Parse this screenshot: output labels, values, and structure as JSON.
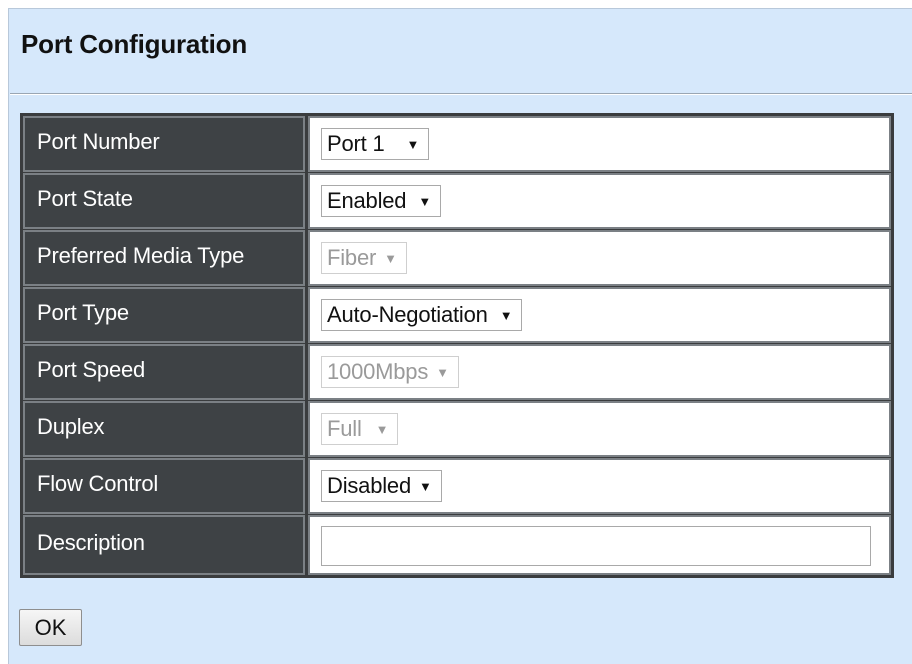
{
  "page": {
    "title": "Port Configuration"
  },
  "form": {
    "rows": [
      {
        "label": "Port Number",
        "control": "select",
        "value": "Port 1",
        "enabled": true
      },
      {
        "label": "Port State",
        "control": "select",
        "value": "Enabled",
        "enabled": true
      },
      {
        "label": "Preferred Media Type",
        "control": "select",
        "value": "Fiber",
        "enabled": false
      },
      {
        "label": "Port Type",
        "control": "select",
        "value": "Auto-Negotiation",
        "enabled": true
      },
      {
        "label": "Port Speed",
        "control": "select",
        "value": "1000Mbps",
        "enabled": false
      },
      {
        "label": "Duplex",
        "control": "select",
        "value": "Full",
        "enabled": false
      },
      {
        "label": "Flow Control",
        "control": "select",
        "value": "Disabled",
        "enabled": true
      },
      {
        "label": "Description",
        "control": "text",
        "value": "",
        "enabled": true
      }
    ]
  },
  "actions": {
    "ok_label": "OK"
  },
  "icons": {
    "dropdown": "chevron-down-icon"
  },
  "colors": {
    "panel_bg": "#d6e8fb",
    "label_bg": "#3e4245",
    "label_text": "#ffffff",
    "disabled_text": "#9a9a9a"
  }
}
